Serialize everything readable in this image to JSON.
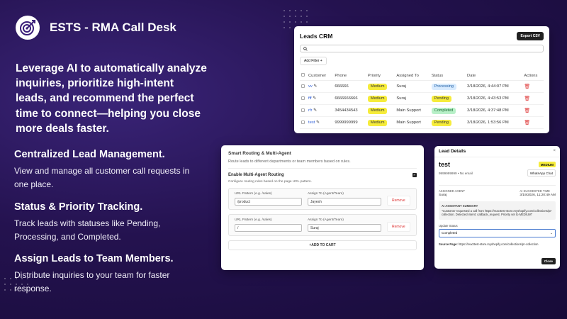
{
  "app": {
    "title": "ESTS - RMA Call Desk"
  },
  "headline": "Leverage AI to automatically analyze inquiries, prioritize high-intent leads, and recommend the perfect time to connect—helping you close more deals faster.",
  "features": [
    {
      "title": "Centralized Lead Management.",
      "desc": "View and manage all customer call requests in one place."
    },
    {
      "title": "Status & Priority Tracking.",
      "desc": "Track leads with statuses like Pending, Processing, and Completed."
    },
    {
      "title": "Assign Leads to Team Members.",
      "desc": "Distribute inquiries to your team for faster response."
    }
  ],
  "crm": {
    "title": "Leads CRM",
    "export_label": "Export CSV",
    "search_placeholder": "",
    "add_filter_label": "Add Filter",
    "columns": [
      "Customer",
      "Phone",
      "Priority",
      "Assigned To",
      "Status",
      "Date",
      "Actions"
    ],
    "rows": [
      {
        "customer": "vv",
        "phone": "666666",
        "priority": "Medium",
        "assigned": "Suraj",
        "status": "Processing",
        "date": "3/18/2026, 4:44:07 PM"
      },
      {
        "customer": "fff",
        "phone": "6666666666",
        "priority": "Medium",
        "assigned": "Suraj",
        "status": "Pending",
        "date": "3/18/2026, 4:43:53 PM"
      },
      {
        "customer": "rfr",
        "phone": "3454434543",
        "priority": "Medium",
        "assigned": "Main Support",
        "status": "Completed",
        "date": "3/18/2026, 4:37:48 PM"
      },
      {
        "customer": "test",
        "phone": "9999999999",
        "priority": "Medium",
        "assigned": "Main Support",
        "status": "Pending",
        "date": "3/18/2026, 1:53:56 PM"
      }
    ]
  },
  "routing": {
    "title": "Smart Routing & Multi-Agent",
    "subtitle": "Route leads to different departments or team members based on rules.",
    "enable_label": "Enable Multi-Agent Routing",
    "config_text": "Configure routing rules based on the page URL pattern.",
    "url_label": "URL Pattern (e.g. /sales)",
    "assign_label": "Assign To (Agent/Team)",
    "remove_label": "Remove",
    "rules": [
      {
        "pattern": "/product",
        "assign": "Jayesh"
      },
      {
        "pattern": "/",
        "assign": "Suraj"
      }
    ],
    "add_label": "+ADD TO CART"
  },
  "details": {
    "title": "Lead Details",
    "name": "test",
    "priority_badge": "MEDIUM",
    "phone_line": "9999999999 • No email",
    "whatsapp_label": "WhatsApp Chat",
    "assigned_label": "ASSIGNED AGENT",
    "assigned_value": "Suraj",
    "suggested_label": "AI SUGGESTED TIME",
    "suggested_value": "3/19/2026, 11:20:49 AM",
    "summary_label": "AI ASSISTANT SUMMARY",
    "summary_text": "\"Customer requested a call from https://reacttest-store.myshopify.com/collections/pr-collection. Detected intent: callback_request. Priority set to MEDIUM\"",
    "update_label": "Update Status",
    "status_value": "Completed",
    "source_label": "Source Page:",
    "source_value": "https://reacttest-store.myshopify.com/collections/pr-collection",
    "close_label": "Close"
  }
}
